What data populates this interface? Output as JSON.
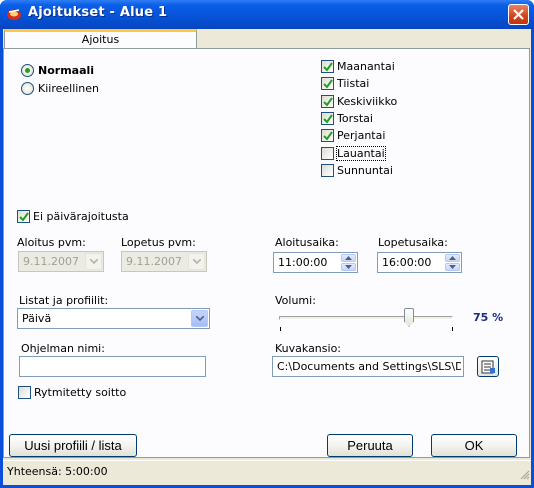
{
  "window": {
    "title": "Ajoitukset - Alue 1"
  },
  "tabs": [
    {
      "label": "Ajoitus"
    }
  ],
  "priority": {
    "options": [
      {
        "label": "Normaali",
        "selected": true
      },
      {
        "label": "Kiireellinen",
        "selected": false
      }
    ]
  },
  "days": [
    {
      "label": "Maanantai",
      "checked": true
    },
    {
      "label": "Tiistai",
      "checked": true
    },
    {
      "label": "Keskiviikko",
      "checked": true
    },
    {
      "label": "Torstai",
      "checked": true
    },
    {
      "label": "Perjantai",
      "checked": true
    },
    {
      "label": "Lauantai",
      "checked": false
    },
    {
      "label": "Sunnuntai",
      "checked": false
    }
  ],
  "no_date_limit": {
    "label": "Ei päivärajoitusta",
    "checked": true
  },
  "dates": {
    "start_label": "Aloitus pvm:",
    "start_value": "9.11.2007",
    "end_label": "Lopetus pvm:",
    "end_value": "9.11.2007"
  },
  "times": {
    "start_label": "Aloitusaika:",
    "start_value": "11:00:00",
    "end_label": "Lopetusaika:",
    "end_value": "16:00:00"
  },
  "lists": {
    "label": "Listat ja profiilit:",
    "selected": "Päivä"
  },
  "volume": {
    "label": "Volumi:",
    "value_text": "75 %",
    "value": 75
  },
  "program": {
    "label": "Ohjelman nimi:",
    "value": ""
  },
  "image_folder": {
    "label": "Kuvakansio:",
    "value": "C:\\Documents and Settings\\SLS\\Deskt"
  },
  "rhythm": {
    "label": "Rytmitetty soitto",
    "checked": false
  },
  "buttons": {
    "new_profile": "Uusi profiili / lista",
    "cancel": "Peruuta",
    "ok": "OK"
  },
  "status": {
    "total": "Yhteensä: 5:00:00"
  },
  "colors": {
    "titlebar": "#0652d6",
    "tab_accent": "#ffc83c",
    "check_green": "#21a121",
    "volume_text": "#1a2e7c"
  }
}
